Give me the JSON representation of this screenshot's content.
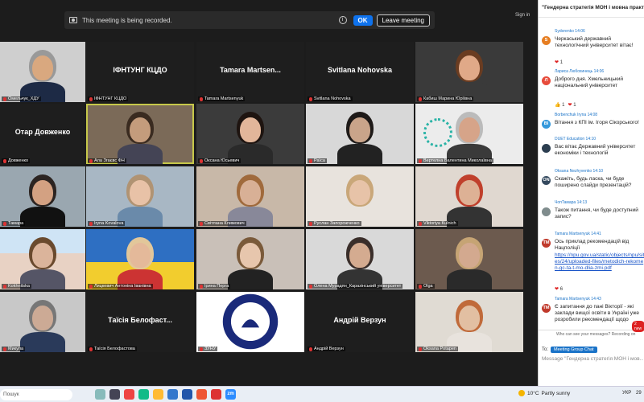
{
  "recording_bar": {
    "text": "This meeting is being recorded.",
    "ok_label": "OK",
    "leave_label": "Leave meeting"
  },
  "sign_in_label": "Sign in",
  "participants": [
    {
      "label": "Омельчук_ХДУ",
      "big_name": ""
    },
    {
      "label": "ІФНТУНГ КЦДО",
      "big_name": "ІФНТУНГ КЦДО"
    },
    {
      "label": "Tamara Martsenyuk",
      "big_name": "Tamara  Martsen..."
    },
    {
      "label": "Svitlana Nohovska",
      "big_name": "Svitlana Nohovska"
    },
    {
      "label": "Кабиш Марина Юріївна",
      "big_name": ""
    },
    {
      "label": "Довженко",
      "big_name": "Отар Довженко"
    },
    {
      "label": "Ала Згаєвс ФН",
      "big_name": ""
    },
    {
      "label": "Оксана Юсьевич",
      "big_name": ""
    },
    {
      "label": "Раїса",
      "big_name": ""
    },
    {
      "label": "Вертелна Валентина Миколаївна",
      "big_name": ""
    },
    {
      "label": "Тамара",
      "big_name": ""
    },
    {
      "label": "Iryna Kovalova",
      "big_name": ""
    },
    {
      "label": "Світлана Климович",
      "big_name": ""
    },
    {
      "label": "Руслан Запорожченко",
      "big_name": ""
    },
    {
      "label": "Viktoriya Kulnich",
      "big_name": ""
    },
    {
      "label": "Kokhnitska",
      "big_name": ""
    },
    {
      "label": "Лицкевич Антоніна Іванівна",
      "big_name": ""
    },
    {
      "label": "Ірина Перга",
      "big_name": ""
    },
    {
      "label": "Олена Мурадян_Каразінський університет",
      "big_name": ""
    },
    {
      "label": "Olga",
      "big_name": ""
    },
    {
      "label": "Микула",
      "big_name": ""
    },
    {
      "label": "Таїсія Белофастова",
      "big_name": "Таїсія Белофаст..."
    },
    {
      "label": "ЗУНУ",
      "big_name": ""
    },
    {
      "label": "Андрій Верзун",
      "big_name": "Андрій Верзун"
    },
    {
      "label": "Oksana Potapen",
      "big_name": ""
    }
  ],
  "chat": {
    "title": "\"Гендерна стратегія МОН і мовна практик...",
    "messages": [
      {
        "sender": "Sydorenko  14:06",
        "initial": "S",
        "color": "#e67e22",
        "text": "Черкаський державний технологічний університет вітає!"
      },
      {
        "sender": "Лариса Любохинець  14:06",
        "initial": "Л",
        "color": "#e74c3c",
        "text": "Доброго дня. Хмельницький національний університет"
      },
      {
        "sender": "Borbenchuk Iryna  14:08",
        "initial": "BI",
        "color": "#3498db",
        "text": "Вітання з КПІ ім. Ігоря Сікорського!"
      },
      {
        "sender": "DUET Education  14:10",
        "initial": "",
        "color": "#2c3e50",
        "text": "Вас вітає Державний університет економіки і технологій"
      },
      {
        "sender": "Oksana Nezhyvenko  14:10",
        "initial": "ON",
        "color": "#34495e",
        "text": "Скажіть, будь ласка, чи буде поширено слайди презентацій?"
      },
      {
        "sender": "ЧопТамара  14:13",
        "initial": "",
        "color": "#7f8c8d",
        "text": "Також питання, чи буде доступний запис?"
      },
      {
        "sender": "Tamara Martsenyuk  14:41",
        "initial": "TM",
        "color": "#c0392b",
        "text": "Ось приклад рекомендацій від Нацполіції",
        "link": "https://npu.gov.ua/static/objects/npu/sites/24/uploaded-files/metodich-rekomen-gc-ta-t-mo-dlia-zmi.pdf"
      },
      {
        "sender": "Tamara Martsenyuk  14:43",
        "initial": "TM",
        "color": "#c0392b",
        "text": "Є запитання до пані Вікторії - які заклади вищої освіти в Україні уже розробили рекомендації щодо"
      }
    ],
    "reactions": [
      {
        "heart": "❤",
        "count": "1"
      },
      {
        "like": "👍",
        "like_count": "1",
        "heart": "❤",
        "count": "1"
      },
      {
        "heart": "❤",
        "count": "6"
      }
    ],
    "who_can_see": "Who can see your messages? Recording on",
    "to_label": "To:",
    "to_target": "Meeting Group Chat",
    "input_placeholder": "Message \"Гендерна стратегія МОН і мов...",
    "new_badge": "2 new"
  },
  "taskbar": {
    "search_placeholder": "Пошук",
    "zoom_label": "zm",
    "weather_temp": "10°C",
    "weather_text": "Partly sunny",
    "lang": "УКР",
    "time": "29"
  }
}
